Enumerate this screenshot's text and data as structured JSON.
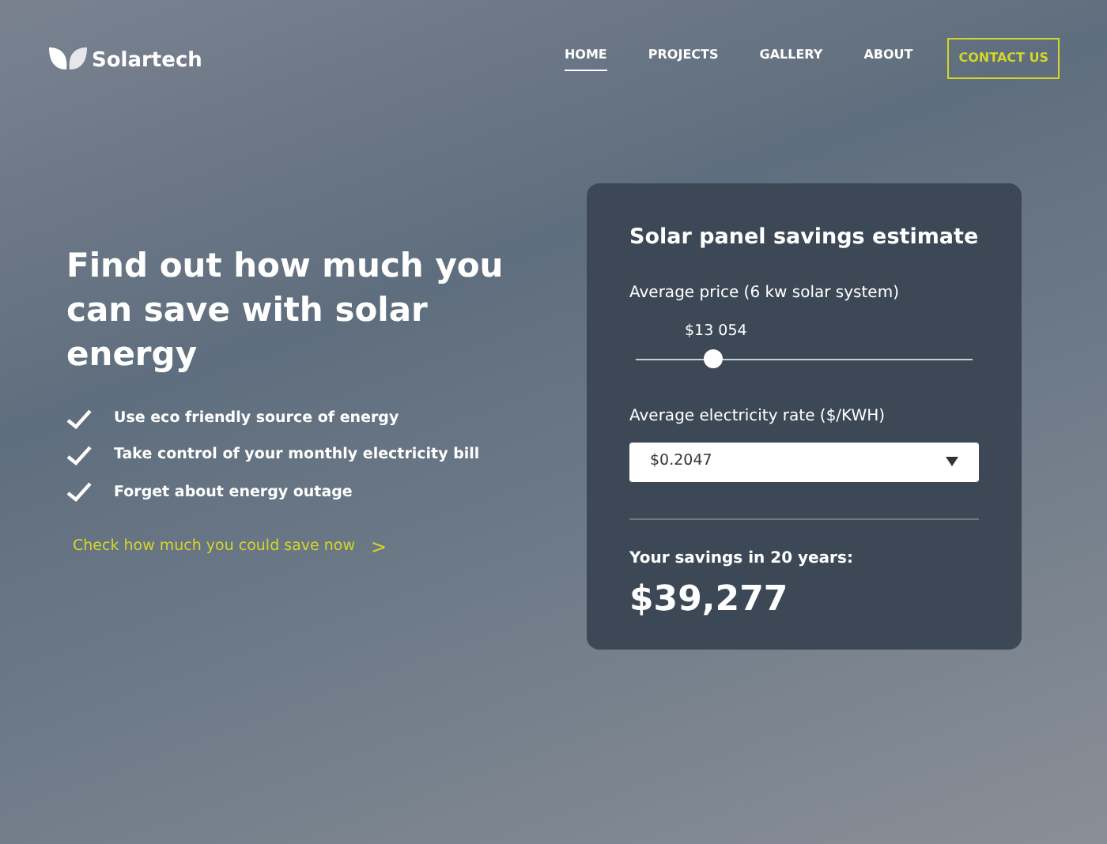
{
  "logo": {
    "text": "Solartech"
  },
  "nav": [
    {
      "label": "HOME",
      "selected": true
    },
    {
      "label": "PROJECTS",
      "selected": false
    },
    {
      "label": "GALLERY",
      "selected": false
    },
    {
      "label": "ABOUT",
      "selected": false
    }
  ],
  "contact_button": "CONTACT US",
  "hero": {
    "headline": "Find out how much you can save with solar energy",
    "features": [
      "Use eco friendly source of energy",
      "Take control of your monthly electricity bill",
      "Forget about energy outage"
    ],
    "cta_link": "Check how much you could save now",
    "cta_arrow": ">"
  },
  "calculator": {
    "title": "Solar panel savings estimate",
    "price_label": "Average price (6 kw solar system)",
    "price_slider": {
      "reading": "$13 054",
      "level": 0.23
    },
    "rate_label": "Average electricity rate ($/KWH)",
    "rate_select": {
      "value": "$0.2047"
    },
    "savings_label": "Your savings in 20 years:",
    "savings_value": "$39,277"
  }
}
